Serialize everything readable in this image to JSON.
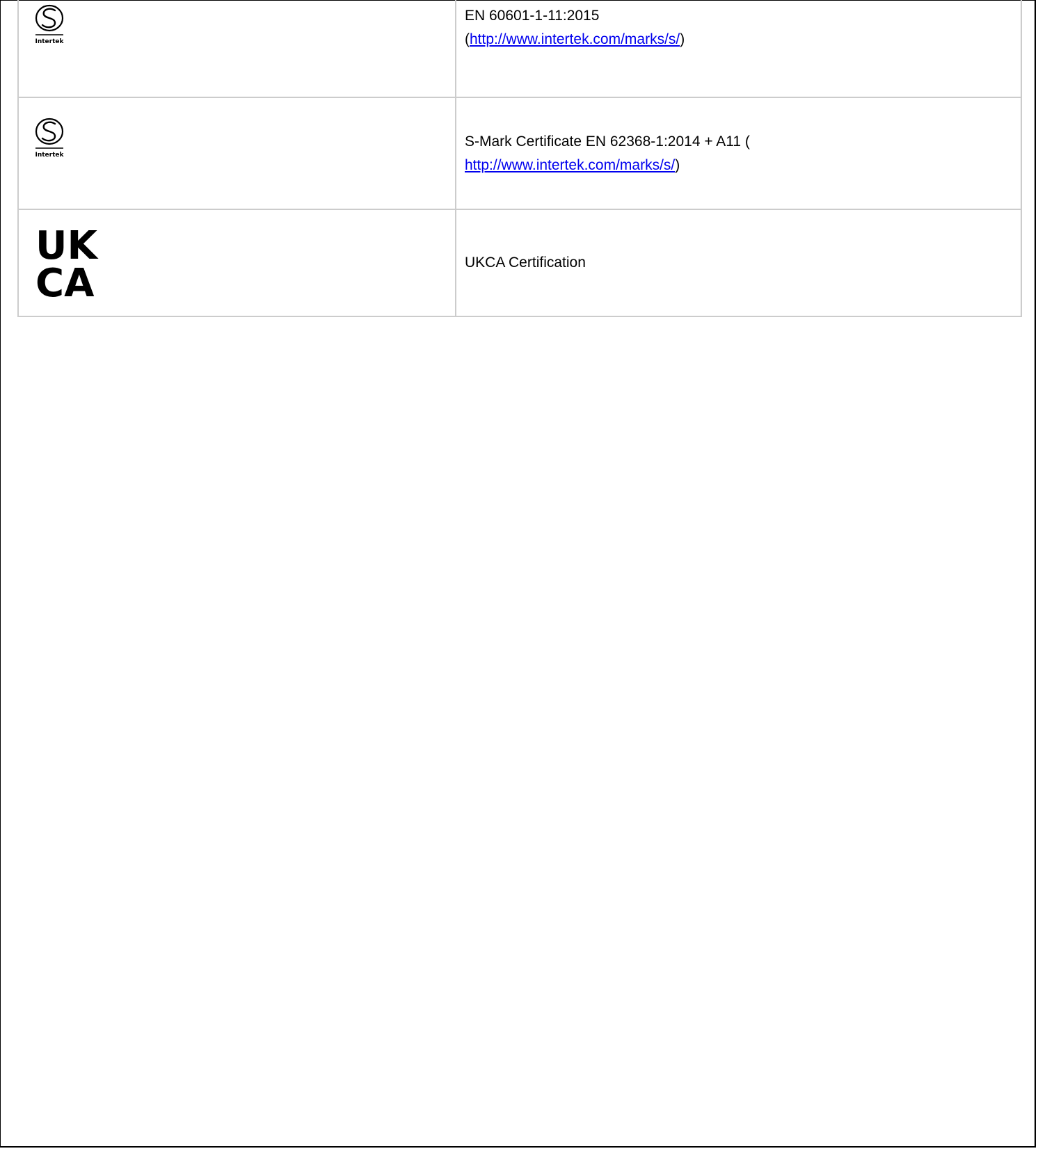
{
  "certifications": [
    {
      "mark": "intertek-s-mark",
      "mark_text": "Intertek",
      "text_lines": [
        "EN 60601-1-11:2015"
      ],
      "link_prefix": "(",
      "link_url": "http://www.intertek.com/marks/s/",
      "link_suffix": ")"
    },
    {
      "mark": "intertek-s-mark",
      "mark_text": "Intertek",
      "text_lines": [
        "S-Mark Certificate EN 62368-1:2014 + A11 ("
      ],
      "link_prefix": "",
      "link_url": "http://www.intertek.com/marks/s/",
      "link_suffix": ")"
    },
    {
      "mark": "ukca-mark",
      "mark_text_top": "UK",
      "mark_text_bottom": "CA",
      "text_lines": [
        "UKCA Certification"
      ]
    }
  ],
  "colors": {
    "border": "#cccccc",
    "link": "#0000ee",
    "text": "#000000"
  }
}
